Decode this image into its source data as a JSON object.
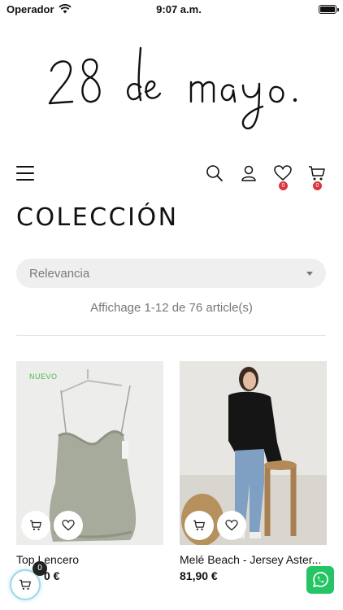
{
  "status_bar": {
    "carrier": "Operador",
    "time": "9:07 a.m."
  },
  "brand": {
    "logo_text": "28 de mayo."
  },
  "header": {
    "wishlist_count": "0",
    "cart_count": "0"
  },
  "page": {
    "title": "COLECCIÓN"
  },
  "sort": {
    "selected": "Relevancia"
  },
  "results": {
    "summary": "Affichage 1-12 de 76 article(s)"
  },
  "products": [
    {
      "badge": "NUEVO",
      "name": "Top Lencero",
      "price": "0 €"
    },
    {
      "badge": "",
      "name": "Melé Beach - Jersey Aster...",
      "price": "81,90 €"
    }
  ],
  "floating_cart": {
    "count": "0"
  },
  "colors": {
    "accent_green": "#4cb848",
    "badge_red": "#d9363e",
    "whatsapp_green": "#25c464"
  }
}
